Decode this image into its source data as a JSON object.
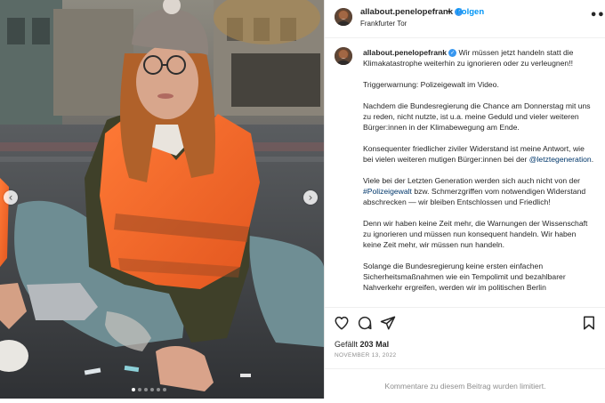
{
  "post": {
    "username": "allabout.penelopefrank",
    "follow_separator": "•",
    "follow_label": "Folgen",
    "location": "Frankfurter Tor",
    "more_icon": "•••",
    "verified_icon": "✓"
  },
  "caption": {
    "username": "allabout.penelopefrank",
    "paragraphs": {
      "p1": "Wir müssen jetzt handeln statt die Klimakatastrophe weiterhin zu ignorieren oder zu verleugnen!!",
      "p2": "Triggerwarnung: Polizeigewalt im Video.",
      "p3": "Nachdem die Bundesregierung die Chance am Donnerstag mit uns zu reden, nicht nutzte, ist u.a. meine Geduld und vieler weiteren Bürger:innen in der Klimabewegung am Ende.",
      "p4_text": "Konsequenter friedlicher ziviler Widerstand ist meine Antwort, wie bei vielen weiteren mutigen Bürger:innen bei der",
      "p4_mention": "@letztegeneration",
      "p4_end": ".",
      "p5_a": "Viele bei der Letzten Generation werden sich auch nicht von der",
      "p5_hashtag": "#Polizeigewalt",
      "p5_b": "bzw. Schmerzgriffen vom notwendigen Widerstand abschrecken — wir bleiben Entschlossen und Friedlich!",
      "p6": "Denn wir haben keine Zeit mehr, die Warnungen der Wissenschaft zu ignorieren und müssen nun konsequent handeln. Wir haben keine Zeit mehr, wir müssen nun handeln.",
      "p7": "Solange die Bundesregierung keine ersten einfachen Sicherheitsmaßnahmen wie ein Tempolimit und bezahlbarer Nahverkehr ergreifen, werden wir im politischen Berlin"
    }
  },
  "carousel": {
    "prev_icon": "‹",
    "next_icon": "›",
    "slide_count": 6,
    "active_slide": 1
  },
  "engagement": {
    "likes_prefix": "Gefällt",
    "likes_count": "203",
    "likes_suffix": "Mal",
    "date": "NOVEMBER 13, 2022"
  },
  "comments": {
    "notice": "Kommentare zu diesem Beitrag wurden limitiert."
  },
  "colors": {
    "link": "#00376b",
    "follow": "#0095f6",
    "verified": "#3897f0",
    "vest": "#f26b2a",
    "muted": "#8e8e8e"
  }
}
